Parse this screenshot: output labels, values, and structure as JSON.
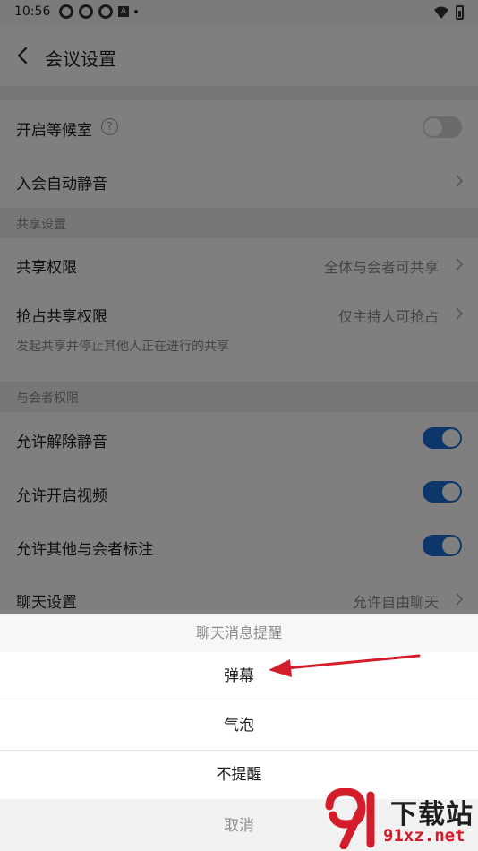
{
  "status_bar": {
    "time": "10:56",
    "badge_letter": "A"
  },
  "nav": {
    "title": "会议设置"
  },
  "settings": {
    "waiting_room": {
      "label": "开启等候室",
      "help": "?"
    },
    "auto_mute": {
      "label": "入会自动静音"
    },
    "share_section": {
      "title": "共享设置"
    },
    "share_permission": {
      "label": "共享权限",
      "value": "全体与会者可共享"
    },
    "grab_share": {
      "label": "抢占共享权限",
      "value": "仅主持人可抢占"
    },
    "grab_share_hint": "发起共享并停止其他人正在进行的共享",
    "participant_section": {
      "title": "与会者权限"
    },
    "allow_unmute": {
      "label": "允许解除静音"
    },
    "allow_video": {
      "label": "允许开启视频"
    },
    "allow_annotate": {
      "label": "允许其他与会者标注"
    },
    "chat": {
      "label": "聊天设置",
      "value": "允许自由聊天"
    }
  },
  "sheet": {
    "title": "聊天消息提醒",
    "options": [
      "弹幕",
      "气泡",
      "不提醒"
    ],
    "cancel": "取消"
  },
  "watermark": {
    "title": "下载站",
    "url": "91xz.net"
  },
  "colors": {
    "accent": "#1a6dd6",
    "arrow": "#d41d2b",
    "watermark_red": "#d41d2b"
  }
}
